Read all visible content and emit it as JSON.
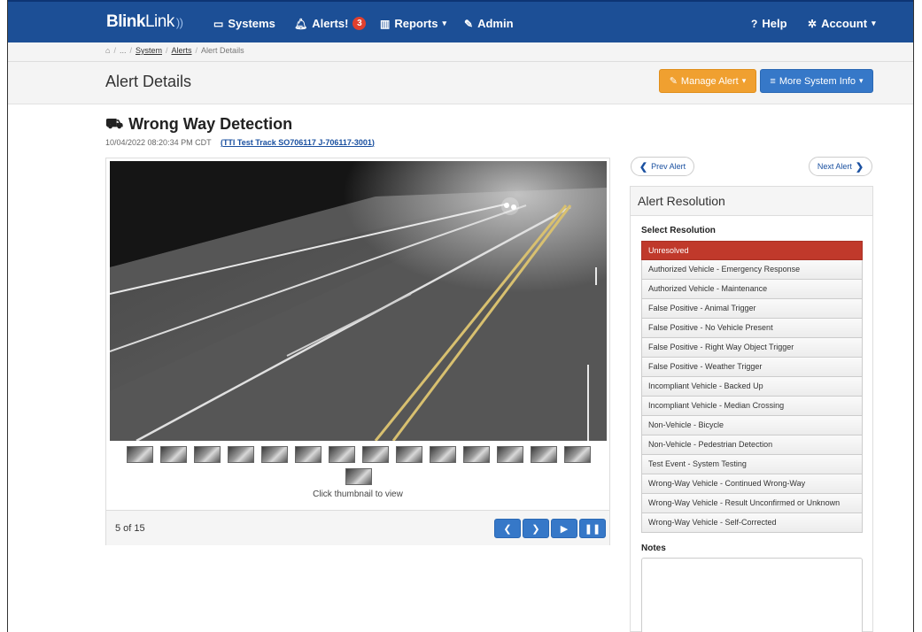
{
  "nav": {
    "brand_bold": "Blink",
    "brand_light": "Link",
    "brand_waves": "))",
    "systems": "Systems",
    "alerts": "Alerts!",
    "alerts_count": "3",
    "reports": "Reports",
    "admin": "Admin",
    "help": "Help",
    "account": "Account"
  },
  "breadcrumb": {
    "home_icon": "home-icon",
    "ellipsis": "...",
    "system": "System",
    "alerts": "Alerts",
    "current": "Alert Details",
    "separator": "/"
  },
  "header": {
    "title": "Alert Details",
    "manage_alert": "Manage Alert",
    "more_system_info": "More System Info"
  },
  "alert": {
    "title": "Wrong Way Detection",
    "timestamp": "10/04/2022 08:20:34 PM CDT",
    "link_open": "(",
    "link": "TTI Test Track SO706117 J-706117-3001",
    "link_close": ")"
  },
  "viewer": {
    "thumbnail_count": 15,
    "caption": "Click thumbnail to view",
    "counter": "5 of 15"
  },
  "nav_alerts": {
    "prev": "Prev Alert",
    "next": "Next Alert"
  },
  "resolution": {
    "header": "Alert Resolution",
    "label": "Select Resolution",
    "options": [
      "Unresolved",
      "Authorized Vehicle - Emergency Response",
      "Authorized Vehicle - Maintenance",
      "False Positive - Animal Trigger",
      "False Positive - No Vehicle Present",
      "False Positive - Right Way Object Trigger",
      "False Positive - Weather Trigger",
      "Incompliant Vehicle - Backed Up",
      "Incompliant Vehicle - Median Crossing",
      "Non-Vehicle - Bicycle",
      "Non-Vehicle - Pedestrian Detection",
      "Test Event - System Testing",
      "Wrong-Way Vehicle - Continued Wrong-Way",
      "Wrong-Way Vehicle - Result Unconfirmed or Unknown",
      "Wrong-Way Vehicle - Self-Corrected"
    ],
    "selected": "Unresolved",
    "notes_label": "Notes",
    "notes_value": ""
  },
  "colors": {
    "navbar": "#1c4f96",
    "manage_button": "#f0a030",
    "primary_button": "#3678c8",
    "selected_resolution": "#c0392b"
  }
}
